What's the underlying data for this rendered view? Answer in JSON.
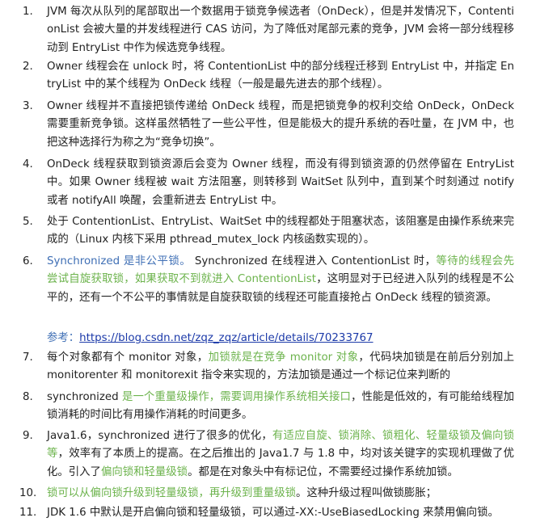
{
  "items": [
    {
      "num": "1.",
      "segments": [
        {
          "t": "JVM 每次从队列的尾部取出一个数据用于锁竞争候选者（OnDeck），但是并发情况下，ContentionList 会被大量的并发线程进行 CAS 访问，为了降低对尾部元素的竞争，JVM 会将一部分线程移动到 EntryList 中作为候选竞争线程。",
          "c": ""
        }
      ]
    },
    {
      "num": "2.",
      "segments": [
        {
          "t": "Owner 线程会在 unlock 时，将 ContentionList 中的部分线程迁移到 EntryList 中，并指定 EntryList 中的某个线程为 OnDeck 线程（一般是最先进去的那个线程）。",
          "c": ""
        }
      ]
    },
    {
      "num": "3.",
      "segments": [
        {
          "t": "Owner 线程并不直接把锁传递给 OnDeck 线程，而是把锁竞争的权利交给 OnDeck，OnDeck 需要重新竞争锁。这样虽然牺牲了一些公平性，但是能极大的提升系统的吞吐量，在 JVM 中，也把这种选择行为称之为“竞争切换”。",
          "c": ""
        }
      ]
    },
    {
      "num": "4.",
      "segments": [
        {
          "t": "OnDeck 线程获取到锁资源后会变为 Owner 线程，而没有得到锁资源的仍然停留在 EntryList 中。如果 Owner 线程被 wait 方法阻塞，则转移到 WaitSet 队列中，直到某个时刻通过 notify 或者 notifyAll 唤醒，会重新进去 EntryList 中。",
          "c": ""
        }
      ]
    },
    {
      "num": "5.",
      "segments": [
        {
          "t": "处于 ContentionList、EntryList、WaitSet 中的线程都处于阻塞状态，该阻塞是由操作系统来完成的（Linux 内核下采用 pthread_mutex_lock 内核函数实现的）。",
          "c": ""
        }
      ]
    },
    {
      "num": "6.",
      "segments": [
        {
          "t": "Synchronized 是非公平锁。",
          "c": "b"
        },
        {
          "t": " Synchronized 在线程进入 ContentionList 时，",
          "c": ""
        },
        {
          "t": "等待的线程会先尝试自旋获取锁，如果获取不到就进入 ContentionList",
          "c": "g"
        },
        {
          "t": "，这明显对于已经进入队列的线程是不公平的，还有一个不公平的事情就是自旋获取锁的线程还可能直接抢占 OnDeck 线程的锁资源。",
          "c": ""
        }
      ],
      "ref_label": "参考：",
      "ref_link": "https://blog.csdn.net/zqz_zqz/article/details/70233767"
    },
    {
      "num": "7.",
      "segments": [
        {
          "t": "每个对象都有个 monitor 对象，",
          "c": ""
        },
        {
          "t": "加锁就是在竞争 monitor 对象",
          "c": "g"
        },
        {
          "t": "，代码块加锁是在前后分别加上 monitorenter 和 monitorexit 指令来实现的，方法加锁是通过一个标记位来判断的",
          "c": ""
        }
      ]
    },
    {
      "num": "8.",
      "segments": [
        {
          "t": "synchronized ",
          "c": ""
        },
        {
          "t": "是一个重量级操作，需要调用操作系统相关接口",
          "c": "g"
        },
        {
          "t": "，性能是低效的，有可能给线程加锁消耗的时间比有用操作消耗的时间更多。",
          "c": ""
        }
      ]
    },
    {
      "num": "9.",
      "segments": [
        {
          "t": "Java1.6，synchronized 进行了很多的优化，",
          "c": ""
        },
        {
          "t": "有适应自旋、锁消除、锁粗化、轻量级锁及偏向锁等",
          "c": "g"
        },
        {
          "t": "，效率有了本质上的提高。在之后推出的 Java1.7 与 1.8 中，均对该关键字的实现机理做了优化。引入了",
          "c": ""
        },
        {
          "t": "偏向锁和轻量级锁",
          "c": "g"
        },
        {
          "t": "。都是在对象头中有标记位，不需要经过操作系统加锁。",
          "c": ""
        }
      ]
    },
    {
      "num": "10.",
      "segments": [
        {
          "t": "锁可以从偏向锁升级到轻量级锁，再升级到重量级锁",
          "c": "g"
        },
        {
          "t": "。这种升级过程叫做锁膨胀；",
          "c": ""
        }
      ]
    },
    {
      "num": "11.",
      "segments": [
        {
          "t": "JDK 1.6 中默认是开启偏向锁和轻量级锁，可以通过-XX:-UseBiasedLocking 来禁用偏向锁。",
          "c": ""
        }
      ]
    }
  ]
}
